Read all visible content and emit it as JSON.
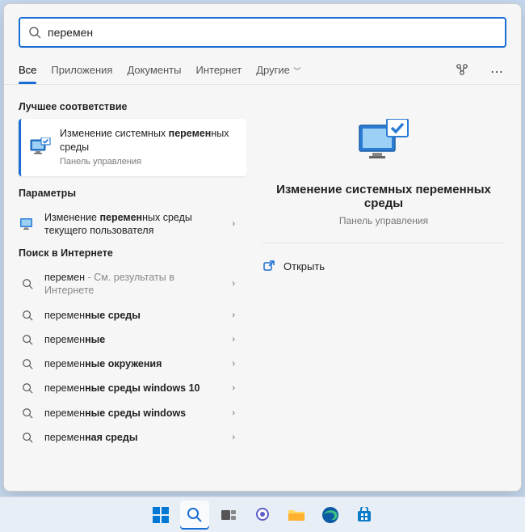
{
  "search": {
    "value": "перемен"
  },
  "tabs": {
    "all": "Все",
    "apps": "Приложения",
    "docs": "Документы",
    "web": "Интернет",
    "more": "Другие"
  },
  "sections": {
    "best": "Лучшее соответствие",
    "params": "Параметры",
    "web": "Поиск в Интернете"
  },
  "bestMatch": {
    "line1_pre": "Изменение системных ",
    "line1_bold": "перемен",
    "line1_post": "ных среды",
    "sub": "Панель управления"
  },
  "paramItem": {
    "pre": "Изменение ",
    "bold": "перемен",
    "post": "ных среды текущего пользователя"
  },
  "webItems": [
    {
      "pre": "",
      "bold": "перемен",
      "post": " ",
      "muted": "- См. результаты в Интернете"
    },
    {
      "pre": "",
      "bold": "перемен",
      "post": "",
      "tail_bold": "ные среды"
    },
    {
      "pre": "",
      "bold": "перемен",
      "post": "",
      "tail_bold": "ные"
    },
    {
      "pre": "",
      "bold": "перемен",
      "post": "",
      "tail_bold": "ные окружения"
    },
    {
      "pre": "",
      "bold": "перемен",
      "post": "",
      "tail_bold": "ные среды windows 10"
    },
    {
      "pre": "",
      "bold": "перемен",
      "post": "",
      "tail_bold": "ные среды windows"
    },
    {
      "pre": "",
      "bold": "перемен",
      "post": "",
      "tail_bold": "ная среды"
    }
  ],
  "preview": {
    "title": "Изменение системных переменных среды",
    "sub": "Панель управления",
    "open": "Открыть"
  }
}
